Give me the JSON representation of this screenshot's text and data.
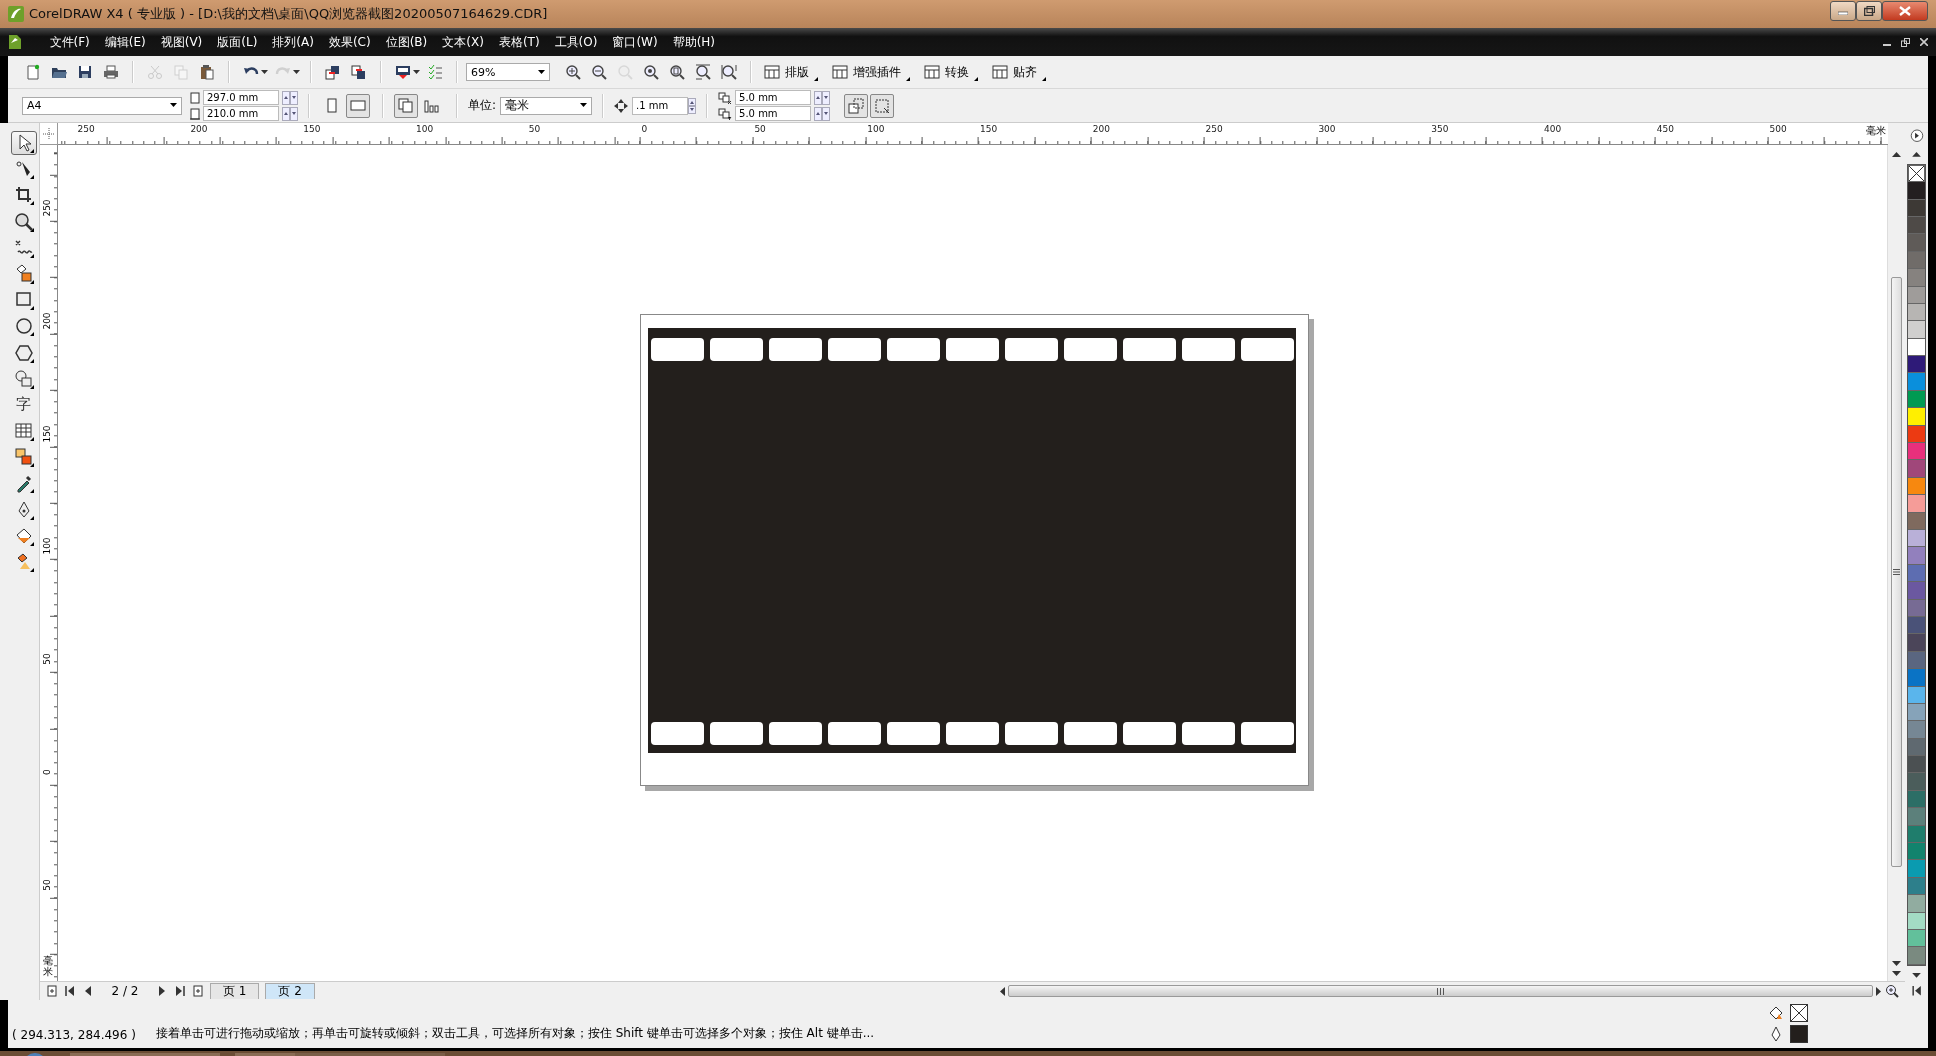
{
  "window": {
    "title": "CorelDRAW X4 ( 专业版 ) - [D:\\我的文档\\桌面\\QQ浏览器截图20200507164629.CDR]"
  },
  "menu": [
    "文件(F)",
    "编辑(E)",
    "视图(V)",
    "版面(L)",
    "排列(A)",
    "效果(C)",
    "位图(B)",
    "文本(X)",
    "表格(T)",
    "工具(O)",
    "窗口(W)",
    "帮助(H)"
  ],
  "standard_toolbar": {
    "buttons": [
      {
        "kind": "new",
        "disabled": false
      },
      {
        "kind": "open",
        "disabled": false
      },
      {
        "kind": "save",
        "disabled": false
      },
      {
        "kind": "print",
        "disabled": false
      },
      {
        "kind": "cut",
        "disabled": true
      },
      {
        "kind": "copy",
        "disabled": true
      },
      {
        "kind": "paste",
        "disabled": false
      },
      {
        "kind": "undo",
        "disabled": false
      },
      {
        "kind": "redo",
        "disabled": true
      },
      {
        "kind": "import",
        "disabled": false
      },
      {
        "kind": "export",
        "disabled": false
      },
      {
        "kind": "launcher",
        "disabled": false
      },
      {
        "kind": "checklist",
        "disabled": false
      }
    ],
    "zoom": "69%",
    "view_buttons": [
      {
        "kind": "zoom-in",
        "disabled": false
      },
      {
        "kind": "zoom-out",
        "disabled": false
      },
      {
        "kind": "zoom-selected",
        "disabled": true
      },
      {
        "kind": "zoom-all",
        "disabled": false
      },
      {
        "kind": "zoom-page",
        "disabled": false
      },
      {
        "kind": "zoom-width",
        "disabled": false
      },
      {
        "kind": "zoom-height",
        "disabled": false
      }
    ],
    "text_buttons": [
      "排版",
      "增强插件",
      "转换",
      "贴齐"
    ]
  },
  "property_bar": {
    "page_size": "A4",
    "width": "297.0 mm",
    "height": "210.0 mm",
    "orientation": [
      {
        "kind": "portrait",
        "selected": false
      },
      {
        "kind": "landscape",
        "selected": true
      }
    ],
    "page_scope": [
      {
        "kind": "all-pages",
        "selected": true
      },
      {
        "kind": "current-page",
        "selected": false
      }
    ],
    "units_label": "单位:",
    "units": "毫米",
    "nudge": ".1 mm",
    "duplicate_x": "5.0 mm",
    "duplicate_y": "5.0 mm"
  },
  "toolbox": [
    {
      "kind": "pick",
      "selected": true
    },
    {
      "kind": "shape",
      "selected": false
    },
    {
      "kind": "crop",
      "selected": false
    },
    {
      "kind": "zoom",
      "selected": false
    },
    {
      "kind": "freehand",
      "selected": false
    },
    {
      "kind": "smart-fill",
      "selected": false
    },
    {
      "kind": "rectangle",
      "selected": false
    },
    {
      "kind": "ellipse",
      "selected": false
    },
    {
      "kind": "polygon",
      "selected": false
    },
    {
      "kind": "basic-shapes",
      "selected": false
    },
    {
      "kind": "text",
      "selected": false,
      "glyph": "字"
    },
    {
      "kind": "table",
      "selected": false
    },
    {
      "kind": "interactive",
      "selected": false
    },
    {
      "kind": "eyedropper",
      "selected": false
    },
    {
      "kind": "outline",
      "selected": false
    },
    {
      "kind": "fill",
      "selected": false
    },
    {
      "kind": "interactive-fill",
      "selected": false
    }
  ],
  "horizontal_ruler": {
    "labels": [
      "250",
      "200",
      "150",
      "100",
      "50",
      "0",
      "50",
      "100",
      "150",
      "200",
      "250",
      "300",
      "350",
      "400",
      "450",
      "500"
    ],
    "unit": "毫米"
  },
  "vertical_ruler": {
    "labels": [
      "250",
      "200",
      "150",
      "100",
      "50",
      "0",
      "50"
    ],
    "unit": "毫米"
  },
  "page": {
    "objects": [
      {
        "kind": "film-strip"
      }
    ]
  },
  "palette": {
    "swatches": [
      {
        "color": "#231f20"
      },
      {
        "color": "#3d3935"
      },
      {
        "color": "#4e4a47"
      },
      {
        "color": "#5f5b58"
      },
      {
        "color": "#706c69"
      },
      {
        "color": "#86827f"
      },
      {
        "color": "#9f9c9a"
      },
      {
        "color": "#b7b5b3"
      },
      {
        "color": "#d0cfce"
      },
      {
        "color": "#ffffff"
      },
      {
        "color": "#2e1a78"
      },
      {
        "color": "#0a8fdc"
      },
      {
        "color": "#009a52"
      },
      {
        "color": "#ffef00"
      },
      {
        "color": "#ec3a12"
      },
      {
        "color": "#e8307c"
      },
      {
        "color": "#a0477a"
      },
      {
        "color": "#f7880f"
      },
      {
        "color": "#f59c98"
      },
      {
        "color": "#7f6a5e"
      },
      {
        "color": "#b9b0d8"
      },
      {
        "color": "#9280bd"
      },
      {
        "color": "#5d6db1"
      },
      {
        "color": "#6b58a0"
      },
      {
        "color": "#776b94"
      },
      {
        "color": "#4a5278"
      },
      {
        "color": "#4b4559"
      },
      {
        "color": "#5a6680"
      },
      {
        "color": "#0a73c5"
      },
      {
        "color": "#5ab5ec"
      },
      {
        "color": "#86a3b9"
      },
      {
        "color": "#768794"
      },
      {
        "color": "#5f6970"
      },
      {
        "color": "#4b5052"
      },
      {
        "color": "#4b5d5b"
      },
      {
        "color": "#2c6e66"
      },
      {
        "color": "#5c807b"
      },
      {
        "color": "#1f7d6c"
      },
      {
        "color": "#12836d"
      },
      {
        "color": "#0a9bb0"
      },
      {
        "color": "#2d7f8b"
      },
      {
        "color": "#91aca0"
      },
      {
        "color": "#a3dbc4"
      },
      {
        "color": "#62c09b"
      },
      {
        "color": "#7a8a80"
      }
    ]
  },
  "page_bar": {
    "counter": "2 / 2",
    "pages": [
      {
        "label": "页 1",
        "selected": false
      },
      {
        "label": "页 2",
        "selected": true
      }
    ]
  },
  "status_bar": {
    "coordinates": "( 294.313, 284.496 )",
    "hint": "接着单击可进行拖动或缩放；再单击可旋转或倾斜；双击工具，可选择所有对象；按住 Shift 键单击可选择多个对象；按住 Alt 键单击..."
  }
}
